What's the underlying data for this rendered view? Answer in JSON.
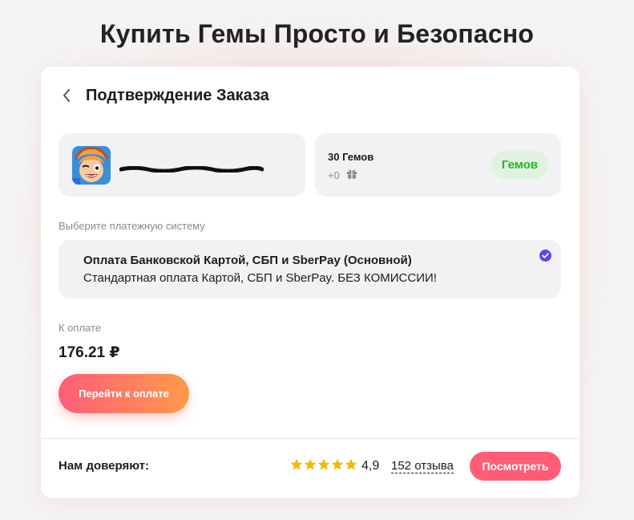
{
  "page": {
    "title": "Купить Гемы Просто и Безопасно"
  },
  "order": {
    "header_title": "Подтверждение Заказа",
    "user": {
      "avatar_icon": "game-character-avatar",
      "email_redacted": true
    },
    "gems": {
      "amount": "30 Гемов",
      "bonus": "+0",
      "bonus_icon": "gift-icon",
      "badge": "Гемов"
    }
  },
  "payment": {
    "label": "Выберите платежную систему",
    "option": {
      "title": "Оплата Банковской Картой, СБП и SberPay (Основной)",
      "description": "Стандартная оплата Картой, СБП и SberPay. БЕЗ КОМИССИИ!",
      "selected": true
    }
  },
  "total": {
    "label": "К оплате",
    "value": "176.21 ₽"
  },
  "actions": {
    "pay_button": "Перейти к оплате"
  },
  "trust": {
    "label": "Нам доверяют:",
    "stars": 5,
    "rating": "4,9",
    "reviews": "152 отзыва",
    "view_button": "Посмотреть"
  },
  "colors": {
    "accent_gradient_start": "#ff5d7a",
    "accent_gradient_end": "#ff9a4a",
    "check": "#6b3df0",
    "badge_text": "#2ab32a",
    "badge_bg": "#dff3df",
    "star": "#f5b800"
  }
}
